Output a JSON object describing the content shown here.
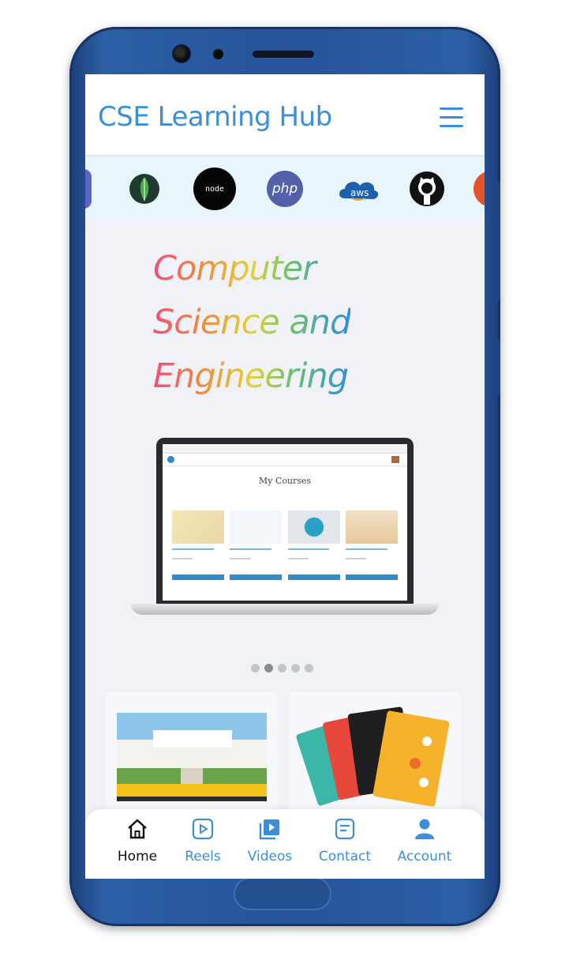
{
  "app": {
    "title": "CSE Learning Hub"
  },
  "tech_icons": [
    {
      "name": "mongodb-icon"
    },
    {
      "name": "nodejs-icon",
      "label": "node"
    },
    {
      "name": "php-icon",
      "label": "php"
    },
    {
      "name": "aws-icon",
      "label": "aws"
    },
    {
      "name": "github-icon"
    }
  ],
  "hero": {
    "line1": "Computer",
    "line2": "Science and",
    "line3": "Engineering"
  },
  "laptop_screen": {
    "heading": "My Courses"
  },
  "carousel": {
    "slides": 5,
    "active_index": 1
  },
  "bottom_nav": [
    {
      "label": "Home",
      "icon": "home-icon"
    },
    {
      "label": "Reels",
      "icon": "reels-icon"
    },
    {
      "label": "Videos",
      "icon": "videos-icon"
    },
    {
      "label": "Contact",
      "icon": "contact-icon"
    },
    {
      "label": "Account",
      "icon": "account-icon"
    }
  ],
  "colors": {
    "accent": "#3b8fd9",
    "phone_frame": "#27549a",
    "screen_bg": "#f1f2f8",
    "tech_strip_bg": "#e8f6fb"
  }
}
